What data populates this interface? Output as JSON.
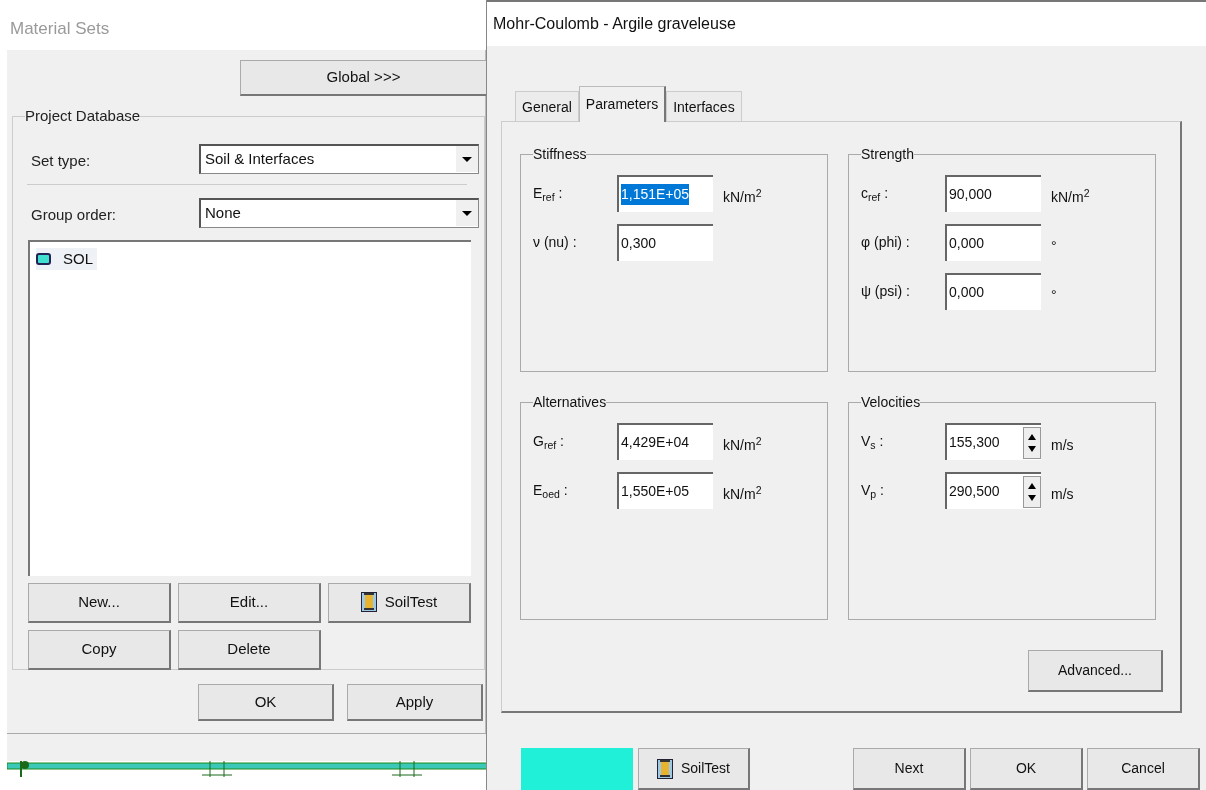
{
  "material_sets": {
    "title": "Material Sets",
    "global_button": "Global >>>",
    "group_title": "Project Database",
    "set_type": {
      "label": "Set type:",
      "value": "Soil & Interfaces"
    },
    "group_order": {
      "label": "Group order:",
      "value": "None"
    },
    "items": [
      {
        "label": "SOL",
        "color": "#40e0d0",
        "selected": false
      }
    ],
    "buttons": [
      {
        "label": "New...",
        "kind": "text"
      },
      {
        "label": "Edit...",
        "kind": "text"
      },
      {
        "label": "SoilTest",
        "kind": "icon"
      },
      {
        "label": "Copy",
        "kind": "text"
      },
      {
        "label": "Delete",
        "kind": "text"
      }
    ],
    "footer_buttons": [
      "OK",
      "Apply"
    ]
  },
  "mohr_coulomb": {
    "title": "Mohr-Coulomb - Argile graveleuse",
    "tabs": [
      {
        "label": "General",
        "selected": false
      },
      {
        "label": "Parameters",
        "selected": true
      },
      {
        "label": "Interfaces",
        "selected": false
      }
    ],
    "groups": [
      {
        "title": "Stiffness",
        "fields": [
          {
            "label": "E$_{ref}$ :",
            "value": "1,151E+05",
            "unit": "kN/m$^{2}$",
            "kind": "text",
            "selected": true
          },
          {
            "label": "ν (nu) :",
            "value": "0,300",
            "kind": "text",
            "selected": false
          }
        ]
      },
      {
        "title": "Strength",
        "fields": [
          {
            "label": "c$_{ref}$ :",
            "value": "90,000",
            "unit": "kN/m$^{2}$",
            "kind": "text",
            "selected": false
          },
          {
            "label": "φ (phi) :",
            "value": "0,000",
            "unit": "°",
            "kind": "text",
            "selected": false
          },
          {
            "label": "ψ (psi) :",
            "value": "0,000",
            "unit": "°",
            "kind": "text",
            "selected": false
          }
        ]
      },
      {
        "title": "Alternatives",
        "fields": [
          {
            "label": "G$_{ref}$ :",
            "value": "4,429E+04",
            "unit": "kN/m$^{2}$",
            "kind": "text",
            "selected": false
          },
          {
            "label": "E$_{oed}$ :",
            "value": "1,550E+05",
            "unit": "kN/m$^{2}$",
            "kind": "text",
            "selected": false
          }
        ]
      },
      {
        "title": "Velocities",
        "fields": [
          {
            "label": "V$_{s}$ :",
            "value": "155,300",
            "unit": "m/s",
            "kind": "spin",
            "selected": false
          },
          {
            "label": "V$_{p}$ :",
            "value": "290,500",
            "unit": "m/s",
            "kind": "spin",
            "selected": false
          }
        ]
      }
    ],
    "advanced_button": "Advanced...",
    "material_color": {
      "color": "#20f0d8"
    },
    "soiltest_button": "SoilTest",
    "footer_buttons": [
      "Next",
      "OK",
      "Cancel"
    ]
  }
}
